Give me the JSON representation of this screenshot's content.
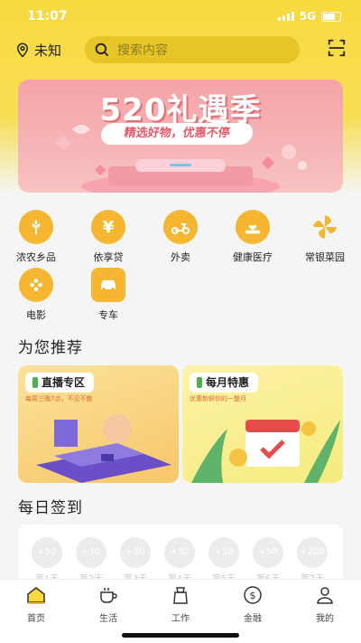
{
  "status": {
    "time": "11:07",
    "network": "5G"
  },
  "header": {
    "location": "未知",
    "search_placeholder": "搜索内容"
  },
  "banner": {
    "title": "520礼遇季",
    "subtitle": "精选好物，优惠不停"
  },
  "categories": [
    {
      "label": "浓农乡品",
      "icon": "wheat-icon",
      "color": "#f5b731"
    },
    {
      "label": "依享贷",
      "icon": "yuan-coin-icon",
      "color": "#f5b731"
    },
    {
      "label": "外卖",
      "icon": "scooter-icon",
      "color": "#f5b731"
    },
    {
      "label": "健康医疗",
      "icon": "hand-heart-icon",
      "color": "#f5b731"
    },
    {
      "label": "常银菜园",
      "icon": "pinwheel-icon",
      "color": "#f5b731"
    },
    {
      "label": "电影",
      "icon": "film-reel-icon",
      "color": "#f5b731"
    },
    {
      "label": "专车",
      "icon": "car-icon",
      "color": "#f5b731"
    }
  ],
  "recommend": {
    "title": "为您推荐",
    "cards": [
      {
        "tag": "直播专区",
        "desc": "每周三晚7点，不见不散"
      },
      {
        "tag": "每月特惠",
        "desc": "优惠新鲜你的一整月"
      }
    ]
  },
  "signin": {
    "title": "每日签到",
    "days": [
      {
        "points": "+50",
        "label": "第1天"
      },
      {
        "points": "+50",
        "label": "第2天"
      },
      {
        "points": "+50",
        "label": "第3天"
      },
      {
        "points": "+50",
        "label": "第4天"
      },
      {
        "points": "+50",
        "label": "第5天"
      },
      {
        "points": "+50",
        "label": "第6天"
      },
      {
        "points": "+200",
        "label": "第7天"
      }
    ]
  },
  "tabbar": [
    {
      "label": "首页",
      "icon": "home-icon",
      "active": true
    },
    {
      "label": "生活",
      "icon": "coffee-cup-icon"
    },
    {
      "label": "工作",
      "icon": "briefcase-icon"
    },
    {
      "label": "金融",
      "icon": "dollar-coin-icon"
    },
    {
      "label": "我的",
      "icon": "user-icon"
    }
  ],
  "colors": {
    "brand_yellow": "#f7d93f",
    "icon_orange": "#f5b731"
  }
}
